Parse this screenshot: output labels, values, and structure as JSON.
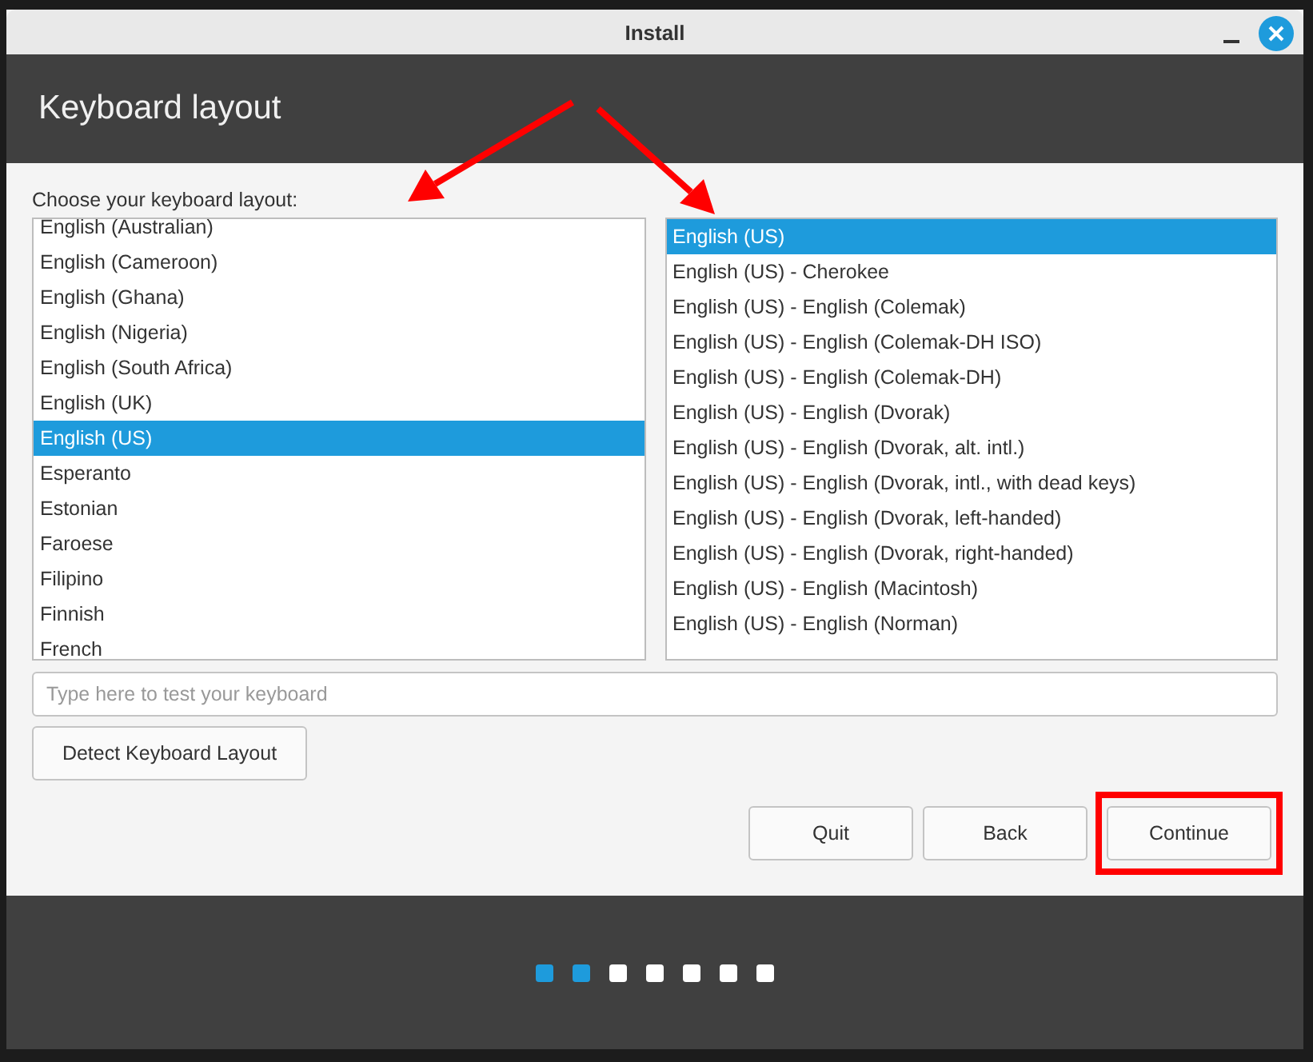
{
  "window": {
    "title": "Install"
  },
  "header": {
    "title": "Keyboard layout"
  },
  "prompt": "Choose your keyboard layout:",
  "layouts": [
    {
      "label": "English (Australian)",
      "selected": false
    },
    {
      "label": "English (Cameroon)",
      "selected": false
    },
    {
      "label": "English (Ghana)",
      "selected": false
    },
    {
      "label": "English (Nigeria)",
      "selected": false
    },
    {
      "label": "English (South Africa)",
      "selected": false
    },
    {
      "label": "English (UK)",
      "selected": false
    },
    {
      "label": "English (US)",
      "selected": true
    },
    {
      "label": "Esperanto",
      "selected": false
    },
    {
      "label": "Estonian",
      "selected": false
    },
    {
      "label": "Faroese",
      "selected": false
    },
    {
      "label": "Filipino",
      "selected": false
    },
    {
      "label": "Finnish",
      "selected": false
    },
    {
      "label": "French",
      "selected": false
    }
  ],
  "variants": [
    {
      "label": "English (US)",
      "selected": true
    },
    {
      "label": "English (US) - Cherokee",
      "selected": false
    },
    {
      "label": "English (US) - English (Colemak)",
      "selected": false
    },
    {
      "label": "English (US) - English (Colemak-DH ISO)",
      "selected": false
    },
    {
      "label": "English (US) - English (Colemak-DH)",
      "selected": false
    },
    {
      "label": "English (US) - English (Dvorak)",
      "selected": false
    },
    {
      "label": "English (US) - English (Dvorak, alt. intl.)",
      "selected": false
    },
    {
      "label": "English (US) - English (Dvorak, intl., with dead keys)",
      "selected": false
    },
    {
      "label": "English (US) - English (Dvorak, left-handed)",
      "selected": false
    },
    {
      "label": "English (US) - English (Dvorak, right-handed)",
      "selected": false
    },
    {
      "label": "English (US) - English (Macintosh)",
      "selected": false
    },
    {
      "label": "English (US) - English (Norman)",
      "selected": false
    }
  ],
  "test_field": {
    "placeholder": "Type here to test your keyboard"
  },
  "detect_button": "Detect Keyboard Layout",
  "buttons": [
    {
      "label": "Quit",
      "highlighted": false
    },
    {
      "label": "Back",
      "highlighted": false
    },
    {
      "label": "Continue",
      "highlighted": true
    }
  ],
  "progress": [
    {
      "done": true
    },
    {
      "done": true
    },
    {
      "done": false
    },
    {
      "done": false
    },
    {
      "done": false
    },
    {
      "done": false
    },
    {
      "done": false
    }
  ]
}
